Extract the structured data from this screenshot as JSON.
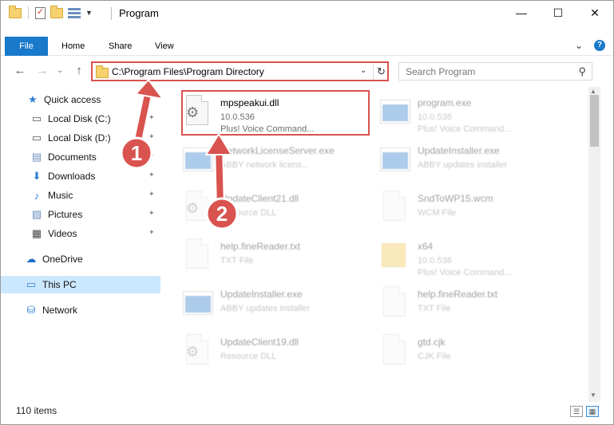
{
  "window": {
    "title": "Program",
    "controls": {
      "minimize": "—",
      "maximize": "☐",
      "close": "✕"
    }
  },
  "ribbon": {
    "tabs": [
      "File",
      "Home",
      "Share",
      "View"
    ],
    "expand_icon": "⌄",
    "help_icon": "?"
  },
  "nav": {
    "back": "←",
    "forward": "→",
    "recent": "⌄",
    "up": "↑",
    "address": "C:\\Program Files\\Program Directory",
    "address_dropdown": "⌄",
    "refresh": "↻",
    "search_placeholder": "Search Program",
    "search_icon": "⚲"
  },
  "sidebar": {
    "items": [
      {
        "label": "Quick access",
        "icon": "★",
        "pinned": false,
        "color": "#2f7fd0"
      },
      {
        "label": "Local Disk (C:)",
        "icon": "▭",
        "pinned": true,
        "color": "#555555"
      },
      {
        "label": "Local Disk (D:)",
        "icon": "▭",
        "pinned": true,
        "color": "#555555"
      },
      {
        "label": "Documents",
        "icon": "▤",
        "pinned": true,
        "color": "#6b8fbf"
      },
      {
        "label": "Downloads",
        "icon": "⬇",
        "pinned": true,
        "color": "#2f7fd0"
      },
      {
        "label": "Music",
        "icon": "♪",
        "pinned": true,
        "color": "#2f7fd0"
      },
      {
        "label": "Pictures",
        "icon": "▨",
        "pinned": true,
        "color": "#6b8fbf"
      },
      {
        "label": "Videos",
        "icon": "▦",
        "pinned": true,
        "color": "#444444"
      },
      {
        "label": "OneDrive",
        "icon": "☁",
        "pinned": false,
        "color": "#1e6fc8"
      },
      {
        "label": "This PC",
        "icon": "▭",
        "pinned": false,
        "color": "#2f7fd0",
        "selected": true
      },
      {
        "label": "Network",
        "icon": "⛁",
        "pinned": false,
        "color": "#2f7fd0"
      }
    ],
    "pin_glyph": "📌"
  },
  "files": [
    {
      "name": "mpspeakui.dll",
      "line1": "10.0.536",
      "line2": "Plus! Voice Command...",
      "type": "dll"
    },
    {
      "name": "program.exe",
      "line1": "10.0.536",
      "line2": "Plus! Voice Command...",
      "type": "exe"
    },
    {
      "name": "NetworkLicenseServer.exe",
      "line1": "ABBY network licens...",
      "line2": "",
      "type": "exe"
    },
    {
      "name": "UpdateInstaller.exe",
      "line1": "ABBY updates installer",
      "line2": "",
      "type": "exe"
    },
    {
      "name": "UpdateClient21.dll",
      "line1": "Resource DLL",
      "line2": "",
      "type": "dll"
    },
    {
      "name": "SndToWP15.wcm",
      "line1": "WCM File",
      "line2": "",
      "type": "doc"
    },
    {
      "name": "help.fineReader.txt",
      "line1": "TXT File",
      "line2": "",
      "type": "doc"
    },
    {
      "name": "x64",
      "line1": "10.0.536",
      "line2": "Plus! Voice Command...",
      "type": "folder"
    },
    {
      "name": "UpdateInstaller.exe",
      "line1": "ABBY updates installer",
      "line2": "",
      "type": "exe"
    },
    {
      "name": "help.fineReader.txt",
      "line1": "TXT File",
      "line2": "",
      "type": "doc"
    },
    {
      "name": "UpdateClient19.dll",
      "line1": "Resource DLL",
      "line2": "",
      "type": "dll"
    },
    {
      "name": "gtd.cjk",
      "line1": "CJK File",
      "line2": "",
      "type": "doc"
    }
  ],
  "status": {
    "item_count": "110 items",
    "details_view_icon": "☰",
    "tiles_view_icon": "▦"
  },
  "annotations": {
    "badge_1": "1",
    "badge_2": "2",
    "accent_color": "#d9534f"
  },
  "scrollbar": {
    "up": "▲",
    "down": "▼"
  }
}
